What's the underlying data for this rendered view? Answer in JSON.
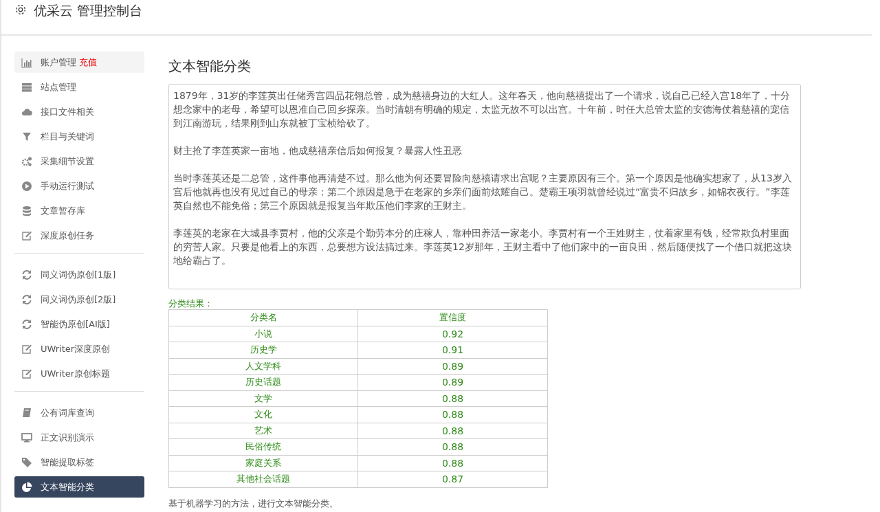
{
  "header": {
    "title": "优采云 管理控制台"
  },
  "sidebar": {
    "groups": [
      {
        "items": [
          {
            "label": "账户管理",
            "badge": "充值",
            "selected": false
          },
          {
            "label": "站点管理",
            "selected": false
          },
          {
            "label": "接口文件相关",
            "selected": false
          },
          {
            "label": "栏目与关键词",
            "selected": false
          },
          {
            "label": "采集细节设置",
            "selected": false
          },
          {
            "label": "手动运行测试",
            "selected": false
          },
          {
            "label": "文章暂存库",
            "selected": false
          },
          {
            "label": "深度原创任务",
            "selected": false
          }
        ]
      },
      {
        "items": [
          {
            "label": "同义词伪原创[1版]",
            "selected": false
          },
          {
            "label": "同义词伪原创[2版]",
            "selected": false
          },
          {
            "label": "智能伪原创[AI版]",
            "selected": false
          },
          {
            "label": "UWriter深度原创",
            "selected": false
          },
          {
            "label": "UWriter原创标题",
            "selected": false
          }
        ]
      },
      {
        "items": [
          {
            "label": "公有词库查询",
            "selected": false
          },
          {
            "label": "正文识别演示",
            "selected": false
          },
          {
            "label": "智能提取标签",
            "selected": false
          },
          {
            "label": "文本智能分类",
            "selected": true
          }
        ]
      }
    ]
  },
  "main": {
    "title": "文本智能分类",
    "input_text": [
      "1879年，31岁的李莲英出任储秀宫四品花翎总管，成为慈禧身边的大红人。这年春天，他向慈禧提出了一个请求，说自己已经入宫18年了，十分想念家中的老母，希望可以恩准自己回乡探亲。当时清朝有明确的规定，太监无故不可以出宫。十年前，时任大总管太监的安德海仗着慈禧的宠信到江南游玩，结果刚到山东就被丁宝桢给砍了。",
      "财主抢了李莲英家一亩地，他成慈禧亲信后如何报复？暴露人性丑恶",
      "当时李莲英还是二总管，这件事他再清楚不过。那么他为何还要冒险向慈禧请求出宫呢？主要原因有三个。第一个原因是他确实想家了，从13岁入宫后他就再也没有见过自己的母亲；第二个原因是急于在老家的乡亲们面前炫耀自己。楚霸王项羽就曾经说过“富贵不归故乡，如锦衣夜行。”李莲英自然也不能免俗；第三个原因就是报复当年欺压他们李家的王财主。",
      "李莲英的老家在大城县李贾村，他的父亲是个勤劳本分的庄稼人，靠种田养活一家老小。李贾村有一个王姓财主，仗着家里有钱，经常欺负村里面的穷苦人家。只要是他看上的东西，总要想方设法搞过来。李莲英12岁那年，王财主看中了他们家中的一亩良田，然后随便找了一个借口就把这块地给霸占了。"
    ],
    "result_label": "分类结果：",
    "table": {
      "columns": [
        "分类名",
        "置信度"
      ],
      "rows": [
        [
          "小说",
          "0.92"
        ],
        [
          "历史学",
          "0.91"
        ],
        [
          "人文学科",
          "0.89"
        ],
        [
          "历史话题",
          "0.89"
        ],
        [
          "文学",
          "0.88"
        ],
        [
          "文化",
          "0.88"
        ],
        [
          "艺术",
          "0.88"
        ],
        [
          "民俗传统",
          "0.88"
        ],
        [
          "家庭关系",
          "0.88"
        ],
        [
          "其他社会话题",
          "0.87"
        ]
      ]
    },
    "note": "基于机器学习的方法，进行文本智能分类。"
  }
}
